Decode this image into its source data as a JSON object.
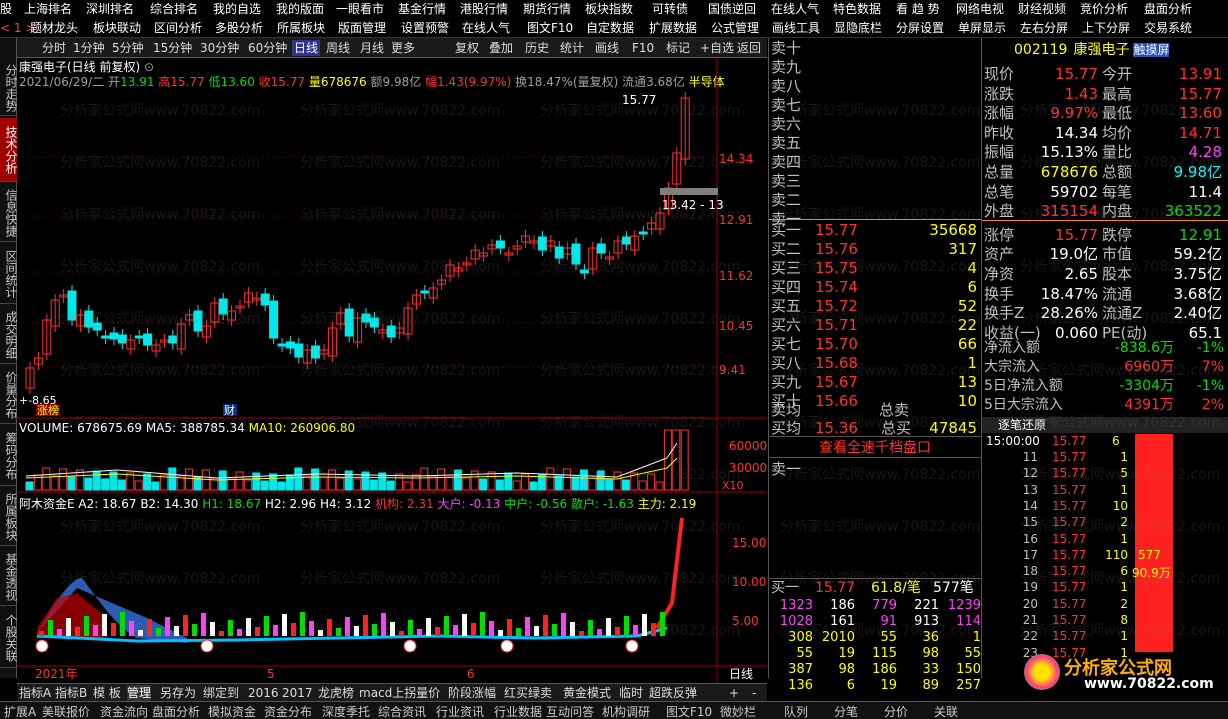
{
  "topmenu": {
    "row1": [
      "上海排名",
      "深圳排名",
      "综合排名",
      "我的自选",
      "我的版面",
      "一眼看市",
      "基金行情",
      "港股行情",
      "期货行情",
      "板块指数",
      "可转债",
      "国债逆回",
      "在线人气",
      "特色数据",
      "看 趋 势",
      "网络电视",
      "财经视频",
      "竞价分析",
      "盘面分析"
    ],
    "row2": [
      "题材龙头",
      "板块联动",
      "区间分析",
      "多股分析",
      "所属板块",
      "版面管理",
      "设置预警",
      "在线人气",
      "图文F10",
      "自定数据",
      "扩展数据",
      "公式管理",
      "画线工具",
      "显隐底栏",
      "分屏设置",
      "单屏显示",
      "左右分屏",
      "上下分屏",
      "交易系统"
    ],
    "left1": "股",
    "left2": "< 1 >"
  },
  "sidebar": [
    "分时走势",
    "技术分析",
    "信息快捷",
    "区间统计",
    "成交明细",
    "价量分布",
    "筹码分布",
    "所属板块",
    "基金透视",
    "个股关联"
  ],
  "toolbar": [
    "分时",
    "1分钟",
    "5分钟",
    "15分钟",
    "30分钟",
    "60分钟",
    "日线",
    "周线",
    "月线",
    "更多",
    "复权",
    "叠加",
    "历史",
    "统计",
    "画线",
    "F10",
    "标记",
    "+自选",
    "返回"
  ],
  "header": {
    "name": "康强电子(日线 前复权)",
    "date": "2021/06/29/二",
    "open_label": "开",
    "open": "13.91",
    "high_label": "高",
    "high": "15.77",
    "low_label": "低",
    "low": "13.60",
    "close_label": "收",
    "close": "15.77",
    "vol_label": "量",
    "vol": "678676",
    "amt_label": "额",
    "amt": "9.98亿",
    "chg_label": "幅",
    "chg": "1.43(9.97%)",
    "turn": "换18.47%(量复权)",
    "float": "流通3.68亿",
    "sector": "半导体"
  },
  "price_axis": [
    "14.34",
    "12.91",
    "11.62",
    "10.45",
    "9.41"
  ],
  "marks": {
    "top": "15.77",
    "box": "13.42 - 13",
    "low": "8.65",
    "tag1": "涨榜",
    "tag2": "财"
  },
  "volume": {
    "label": "VOLUME: 678675.69",
    "ma5": "MA5: 388785.34",
    "ma10": "MA10: 260906.80",
    "axis": [
      "60000",
      "30000"
    ],
    "unit": "X10"
  },
  "indicator": {
    "name": "阿木资金E",
    "a2": "A2: 18.67",
    "b2": "B2: 14.30",
    "h1": "H1: 18.67",
    "h2": "H2: 2.96",
    "h4": "H4: 3.12",
    "jg": "机构: 2.31",
    "dh": "大户: -0.13",
    "zh": "中户: -0.56",
    "sh": "散户: -1.63",
    "zl": "主力: 2.19",
    "axis": [
      "15.00",
      "10.00",
      "5.00"
    ]
  },
  "xaxis": {
    "y": "2021年",
    "m5": "5",
    "m6": "6",
    "period": "日线"
  },
  "bottombar": [
    "指标A",
    "指标B",
    "模 板",
    "管理",
    "另存为",
    "绑定到",
    "2016",
    "2017",
    "龙虎榜",
    "macd上拐量价",
    "阶段涨幅",
    "红买绿卖",
    "黄金模式",
    "临时",
    "超跌反弹"
  ],
  "orderbook": {
    "sell": [
      [
        "卖十",
        "",
        ""
      ],
      [
        "卖九",
        "",
        ""
      ],
      [
        "卖八",
        "",
        ""
      ],
      [
        "卖七",
        "",
        ""
      ],
      [
        "卖六",
        "",
        ""
      ],
      [
        "卖五",
        "",
        ""
      ],
      [
        "卖四",
        "",
        ""
      ],
      [
        "卖三",
        "",
        ""
      ],
      [
        "卖二",
        "",
        ""
      ],
      [
        "卖一",
        "",
        ""
      ]
    ],
    "buy": [
      [
        "买一",
        "15.77",
        "35668"
      ],
      [
        "买二",
        "15.76",
        "317"
      ],
      [
        "买三",
        "15.75",
        "4"
      ],
      [
        "买四",
        "15.74",
        "6"
      ],
      [
        "买五",
        "15.72",
        "52"
      ],
      [
        "买六",
        "15.71",
        "22"
      ],
      [
        "买七",
        "15.70",
        "66"
      ],
      [
        "买八",
        "15.68",
        "1"
      ],
      [
        "买九",
        "15.67",
        "13"
      ],
      [
        "买十",
        "15.66",
        "10"
      ]
    ],
    "avg_sell_label": "卖均",
    "total_sell_label": "总卖",
    "avg_buy_label": "买均",
    "avg_buy": "15.36",
    "total_buy_label": "总买",
    "total_buy": "47845",
    "link": "查看全速千档盘口",
    "s1": "卖一",
    "b1_label": "买一",
    "b1_price": "15.77",
    "b1_qty": "61.8/笔",
    "b1_cnt": "577笔",
    "queue": [
      [
        "1323",
        "186",
        "779",
        "221",
        "1239"
      ],
      [
        "1028",
        "161",
        "91",
        "913",
        "114"
      ],
      [
        "308",
        "2010",
        "55",
        "36",
        "1"
      ],
      [
        "55",
        "19",
        "115",
        "98",
        "55"
      ],
      [
        "387",
        "98",
        "186",
        "33",
        "150"
      ],
      [
        "136",
        "6",
        "19",
        "89",
        "257"
      ]
    ]
  },
  "quote": {
    "code": "002119",
    "name": "康强电子",
    "touch": "触摸屏",
    "rows": [
      [
        "现价",
        "15.77",
        "今开",
        "13.91"
      ],
      [
        "涨跌",
        "1.43",
        "最高",
        "15.77"
      ],
      [
        "涨幅",
        "9.97%",
        "最低",
        "13.60"
      ],
      [
        "昨收",
        "14.34",
        "均价",
        "14.71"
      ],
      [
        "振幅",
        "15.13%",
        "量比",
        "4.28"
      ],
      [
        "总量",
        "678676",
        "总额",
        "9.98亿"
      ],
      [
        "总笔",
        "59702",
        "每笔",
        "11.4"
      ],
      [
        "外盘",
        "315154",
        "内盘",
        "363522"
      ],
      [
        "涨停",
        "15.77",
        "跌停",
        "12.91"
      ],
      [
        "资产",
        "19.0亿",
        "市值",
        "59.2亿"
      ],
      [
        "净资",
        "2.65",
        "股本",
        "3.75亿"
      ],
      [
        "换手",
        "18.47%",
        "流通",
        "3.68亿"
      ],
      [
        "换手Z",
        "28.26%",
        "流通Z",
        "2.40亿"
      ],
      [
        "收益(一)",
        "0.060",
        "PE(动)",
        "65.1"
      ]
    ],
    "flow": [
      [
        "净流入额",
        "-838.6万",
        "-1%"
      ],
      [
        "大宗流入",
        "6960万",
        "7%"
      ],
      [
        "5日净流入额",
        "-3304万",
        "-1%"
      ],
      [
        "5日大宗流入",
        "4391万",
        "2%"
      ]
    ],
    "tick_title": "逐笔还原",
    "tick_time": "15:00:00",
    "ticks": [
      [
        "11",
        "15.77",
        "1"
      ],
      [
        "12",
        "15.77",
        "5"
      ],
      [
        "13",
        "15.77",
        "1"
      ],
      [
        "14",
        "15.77",
        "10"
      ],
      [
        "15",
        "15.77",
        "2"
      ],
      [
        "16",
        "15.77",
        "1"
      ],
      [
        "17",
        "15.77",
        "110"
      ],
      [
        "18",
        "15.77",
        "6"
      ],
      [
        "19",
        "15.77",
        "1"
      ],
      [
        "20",
        "15.77",
        "2"
      ],
      [
        "21",
        "15.77",
        "8"
      ],
      [
        "22",
        "15.77",
        "1"
      ],
      [
        "23",
        "15.77",
        "1"
      ]
    ],
    "tick0": [
      "",
      "15.77",
      "6"
    ],
    "bar_label1": "577",
    "bar_label2": "90.9万",
    "logo": "分析家公式网",
    "logo_url": "www.70822.com"
  },
  "bottom2": [
    "扩展A",
    "美联报价",
    "资金流向",
    "盘面分析",
    "模拟资金",
    "资金分布",
    "深度季托",
    "综合资讯",
    "行业资讯",
    "行业数据",
    "互动问答",
    "机构调研",
    "图文F10",
    "微妙栏"
  ],
  "bottom2_right": [
    "队列",
    "分笔",
    "分价",
    "关联"
  ]
}
